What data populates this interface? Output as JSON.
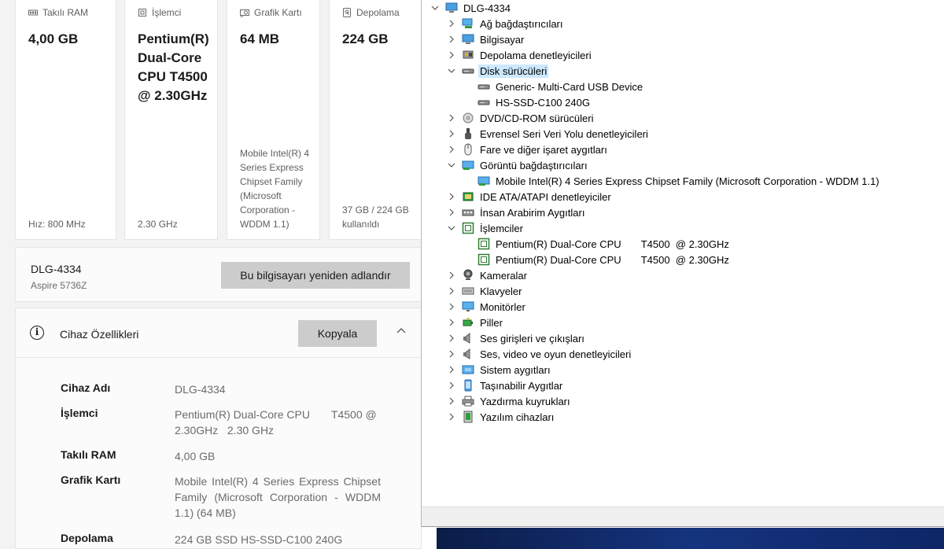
{
  "specs_cards": [
    {
      "header": "Takılı RAM",
      "value": "4,00 GB",
      "footer": "Hız: 800 MHz",
      "icon": "ram-icon"
    },
    {
      "header": "İşlemci",
      "value": "Pentium(R) Dual-Core CPU T4500 @ 2.30GHz",
      "footer": "2.30 GHz",
      "icon": "cpu-icon"
    },
    {
      "header": "Grafik Kartı",
      "value": "64 MB",
      "footer": "Mobile Intel(R) 4 Series Express Chipset Family (Microsoft Corporation - WDDM 1.1)",
      "icon": "gpu-icon"
    },
    {
      "header": "Depolama",
      "value": "224 GB",
      "footer": "37 GB / 224 GB kullanıldı",
      "icon": "storage-icon"
    }
  ],
  "device": {
    "name": "DLG-4334",
    "model": "Aspire 5736Z",
    "rename_label": "Bu bilgisayarı yeniden adlandır"
  },
  "device_specs": {
    "title": "Cihaz Özellikleri",
    "copy_label": "Kopyala",
    "rows": [
      {
        "label": "Cihaz Adı",
        "value": "DLG-4334"
      },
      {
        "label": "İşlemci",
        "value": "Pentium(R) Dual-Core CPU       T4500 @ 2.30GHz   2.30 GHz"
      },
      {
        "label": "Takılı RAM",
        "value": "4,00 GB"
      },
      {
        "label": "Grafik Kartı",
        "value": "Mobile Intel(R) 4 Series Express Chipset Family (Microsoft Corporation - WDDM 1.1) (64 MB)"
      },
      {
        "label": "Depolama",
        "value": "224 GB SSD HS-SSD-C100 240G"
      }
    ]
  },
  "device_manager": {
    "root": "DLG-4334",
    "categories": [
      {
        "label": "Ağ bağdaştırıcıları",
        "icon": "network-adapter-icon",
        "expanded": false
      },
      {
        "label": "Bilgisayar",
        "icon": "computer-icon",
        "expanded": false
      },
      {
        "label": "Depolama denetleyicileri",
        "icon": "storage-controller-icon",
        "expanded": false
      },
      {
        "label": "Disk sürücüleri",
        "icon": "disk-drive-icon",
        "expanded": true,
        "selected": true,
        "children": [
          {
            "label": "Generic- Multi-Card USB Device",
            "icon": "disk-drive-icon"
          },
          {
            "label": "HS-SSD-C100 240G",
            "icon": "disk-drive-icon"
          }
        ]
      },
      {
        "label": "DVD/CD-ROM sürücüleri",
        "icon": "dvd-drive-icon",
        "expanded": false
      },
      {
        "label": "Evrensel Seri Veri Yolu denetleyicileri",
        "icon": "usb-icon",
        "expanded": false
      },
      {
        "label": "Fare ve diğer işaret aygıtları",
        "icon": "mouse-icon",
        "expanded": false
      },
      {
        "label": "Görüntü bağdaştırıcıları",
        "icon": "display-adapter-icon",
        "expanded": true,
        "children": [
          {
            "label": "Mobile Intel(R) 4 Series Express Chipset Family (Microsoft Corporation - WDDM 1.1)",
            "icon": "display-adapter-icon"
          }
        ]
      },
      {
        "label": "IDE ATA/ATAPI denetleyiciler",
        "icon": "ide-controller-icon",
        "expanded": false
      },
      {
        "label": "İnsan Arabirim Aygıtları",
        "icon": "hid-icon",
        "expanded": false
      },
      {
        "label": "İşlemciler",
        "icon": "processor-icon",
        "expanded": true,
        "children": [
          {
            "label": "Pentium(R) Dual-Core CPU       T4500  @ 2.30GHz",
            "icon": "processor-icon"
          },
          {
            "label": "Pentium(R) Dual-Core CPU       T4500  @ 2.30GHz",
            "icon": "processor-icon"
          }
        ]
      },
      {
        "label": "Kameralar",
        "icon": "camera-icon",
        "expanded": false
      },
      {
        "label": "Klavyeler",
        "icon": "keyboard-icon",
        "expanded": false
      },
      {
        "label": "Monitörler",
        "icon": "monitor-icon",
        "expanded": false
      },
      {
        "label": "Piller",
        "icon": "battery-icon",
        "expanded": false
      },
      {
        "label": "Ses girişleri ve çıkışları",
        "icon": "speaker-icon",
        "expanded": false
      },
      {
        "label": "Ses, video ve oyun denetleyicileri",
        "icon": "speaker-icon",
        "expanded": false
      },
      {
        "label": "Sistem aygıtları",
        "icon": "system-device-icon",
        "expanded": false
      },
      {
        "label": "Taşınabilir Aygıtlar",
        "icon": "portable-device-icon",
        "expanded": false
      },
      {
        "label": "Yazdırma kuyrukları",
        "icon": "printer-icon",
        "expanded": false
      },
      {
        "label": "Yazılım cihazları",
        "icon": "software-device-icon",
        "expanded": false
      }
    ]
  },
  "colors": {
    "selection": "#cce8ff",
    "button_bg": "#cccccc",
    "panel_bg": "#f3f3f3",
    "taskbar": "#15347f"
  }
}
